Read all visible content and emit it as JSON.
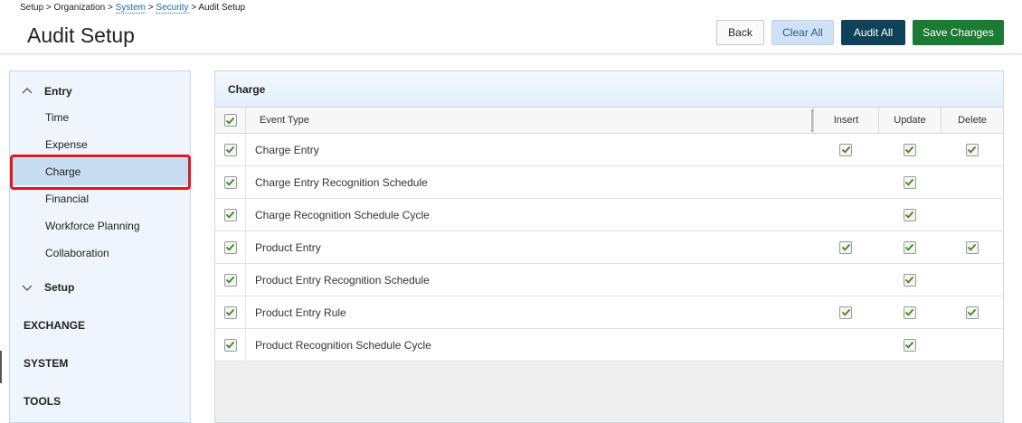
{
  "breadcrumb": {
    "setup": "Setup",
    "organization": "Organization",
    "system": "System",
    "security": "Security",
    "current": "Audit Setup",
    "sep": ">"
  },
  "page": {
    "title": "Audit Setup"
  },
  "toolbar": {
    "back_label": "Back",
    "clear_all_label": "Clear All",
    "audit_all_label": "Audit All",
    "save_changes_label": "Save Changes"
  },
  "sidebar": {
    "entry": {
      "label": "Entry",
      "items": [
        {
          "label": "Time"
        },
        {
          "label": "Expense"
        },
        {
          "label": "Charge",
          "active": true
        },
        {
          "label": "Financial"
        },
        {
          "label": "Workforce Planning"
        },
        {
          "label": "Collaboration"
        }
      ]
    },
    "setup": {
      "label": "Setup"
    },
    "categories": [
      "EXCHANGE",
      "SYSTEM",
      "TOOLS"
    ]
  },
  "panel": {
    "title": "Charge",
    "columns": {
      "event_type": "Event Type",
      "insert": "Insert",
      "update": "Update",
      "delete": "Delete"
    },
    "rows": [
      {
        "name": "Charge Entry",
        "insert": true,
        "update": true,
        "delete": true
      },
      {
        "name": "Charge Entry Recognition Schedule",
        "insert": false,
        "update": true,
        "delete": false
      },
      {
        "name": "Charge Recognition Schedule Cycle",
        "insert": false,
        "update": true,
        "delete": false
      },
      {
        "name": "Product Entry",
        "insert": true,
        "update": true,
        "delete": true
      },
      {
        "name": "Product Entry Recognition Schedule",
        "insert": false,
        "update": true,
        "delete": false
      },
      {
        "name": "Product Entry Rule",
        "insert": true,
        "update": true,
        "delete": true
      },
      {
        "name": "Product Recognition Schedule Cycle",
        "insert": false,
        "update": true,
        "delete": false
      }
    ]
  },
  "colors": {
    "check": "#3d8a1f",
    "audit_all_bg": "#0e4259",
    "save_bg": "#1d7a34",
    "clear_all_bg": "#cfe2f5",
    "highlight": "#e5151e"
  },
  "icons": {
    "checkmark": "checkmark-icon",
    "chevron_up": "chevron-up-icon",
    "chevron_down": "chevron-down-icon"
  }
}
